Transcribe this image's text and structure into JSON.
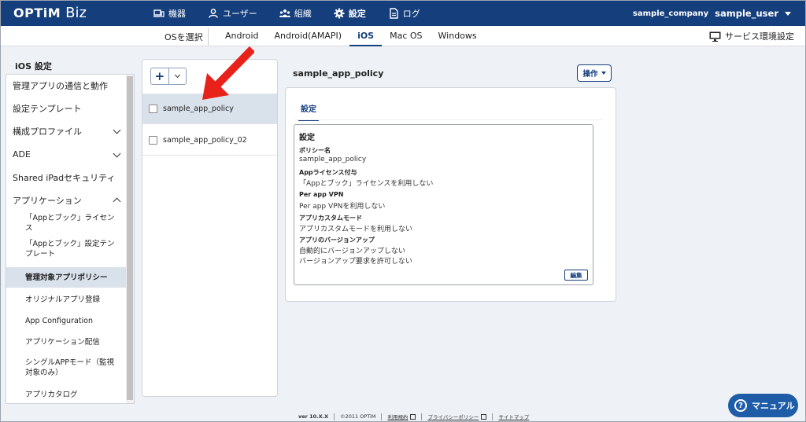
{
  "header": {
    "logo_brand": "OPTiM",
    "logo_product": "Biz",
    "nav": [
      {
        "label": "機器",
        "icon": "devices-icon"
      },
      {
        "label": "ユーザー",
        "icon": "user-icon"
      },
      {
        "label": "組織",
        "icon": "organization-icon"
      },
      {
        "label": "設定",
        "icon": "gear-icon"
      },
      {
        "label": "ログ",
        "icon": "log-document-icon"
      }
    ],
    "active_nav": "設定",
    "company": "sample_company",
    "user": "sample_user"
  },
  "os_bar": {
    "select_label": "OSを選択",
    "tabs": [
      "Android",
      "Android(AMAPI)",
      "iOS",
      "Mac OS",
      "Windows"
    ],
    "active_tab": "iOS",
    "service_settings": "サービス環境設定"
  },
  "sidebar": {
    "title": "iOS 設定",
    "items": [
      {
        "label": "管理アプリの通信と動作"
      },
      {
        "label": "設定テンプレート"
      },
      {
        "label": "構成プロファイル"
      },
      {
        "label": "ADE"
      },
      {
        "label": "Shared iPadセキュリティ"
      },
      {
        "label": "アプリケーション"
      },
      {
        "label": "「Appとブック」ライセンス"
      },
      {
        "label": "「Appとブック」設定テンプレート"
      },
      {
        "label": "管理対象アプリポリシー"
      },
      {
        "label": "オリジナルアプリ登録"
      },
      {
        "label": "App Configuration"
      },
      {
        "label": "アプリケーション配信"
      },
      {
        "label": "シングルAPPモード（監視対象のみ）"
      },
      {
        "label": "アプリカタログ"
      }
    ]
  },
  "policy_list": {
    "add_label": "+",
    "items": [
      {
        "name": "sample_app_policy"
      },
      {
        "name": "sample_app_policy_02"
      }
    ]
  },
  "detail": {
    "title": "sample_app_policy",
    "operation_label": "操作",
    "tab_label": "設定",
    "section_title": "設定",
    "fields": [
      {
        "label": "ポリシー名",
        "values": [
          "sample_app_policy"
        ]
      },
      {
        "label": "Appライセンス付与",
        "values": [
          "「Appとブック」ライセンスを利用しない"
        ]
      },
      {
        "label": "Per app VPN",
        "values": [
          "Per app VPNを利用しない"
        ]
      },
      {
        "label": "アプリカスタムモード",
        "values": [
          "アプリカスタムモードを利用しない"
        ]
      },
      {
        "label": "アプリのバージョンアップ",
        "values": [
          "自動的にバージョンアップしない",
          "バージョンアップ要求を許可しない"
        ]
      }
    ],
    "edit_label": "編集"
  },
  "footer": {
    "version": "ver 10.X.X",
    "copyright": "©2011 OPTiM",
    "terms": "利用規約",
    "privacy": "プライバシーポリシー",
    "sitemap": "サイトマップ"
  },
  "manual_button": "マニュアル",
  "colors": {
    "header_bg": "#143e7c",
    "accent": "#143e7c",
    "selection_bg": "#d9e1eb",
    "manual_bg": "#1e5ca8",
    "arrow": "#e8211b"
  }
}
